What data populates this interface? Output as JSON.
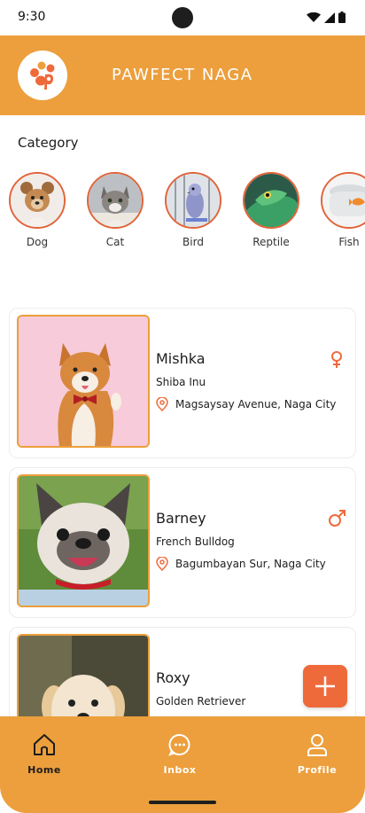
{
  "status_bar": {
    "time": "9:30"
  },
  "header": {
    "title": "PAWFECT NAGA",
    "logo_icon": "paw-logo-icon"
  },
  "category": {
    "heading": "Category",
    "items": [
      {
        "label": "Dog",
        "icon": "dog-photo"
      },
      {
        "label": "Cat",
        "icon": "cat-photo"
      },
      {
        "label": "Bird",
        "icon": "bird-photo"
      },
      {
        "label": "Reptile",
        "icon": "reptile-photo"
      },
      {
        "label": "Fish",
        "icon": "fish-photo"
      }
    ]
  },
  "pets": [
    {
      "name": "Mishka",
      "breed": "Shiba Inu",
      "location": "Magsaysay Avenue, Naga City",
      "gender": "female"
    },
    {
      "name": "Barney",
      "breed": "French Bulldog",
      "location": "Bagumbayan Sur, Naga City",
      "gender": "male"
    },
    {
      "name": "Roxy",
      "breed": "Golden Retriever",
      "location": "",
      "gender": ""
    }
  ],
  "fab": {
    "icon": "plus-icon"
  },
  "nav": {
    "home": "Home",
    "inbox": "Inbox",
    "profile": "Profile"
  },
  "colors": {
    "brand": "#ec9f3c",
    "accent": "#ef6a3b",
    "nav_active": "#1d1d1d",
    "nav_inactive": "#ffffff"
  }
}
